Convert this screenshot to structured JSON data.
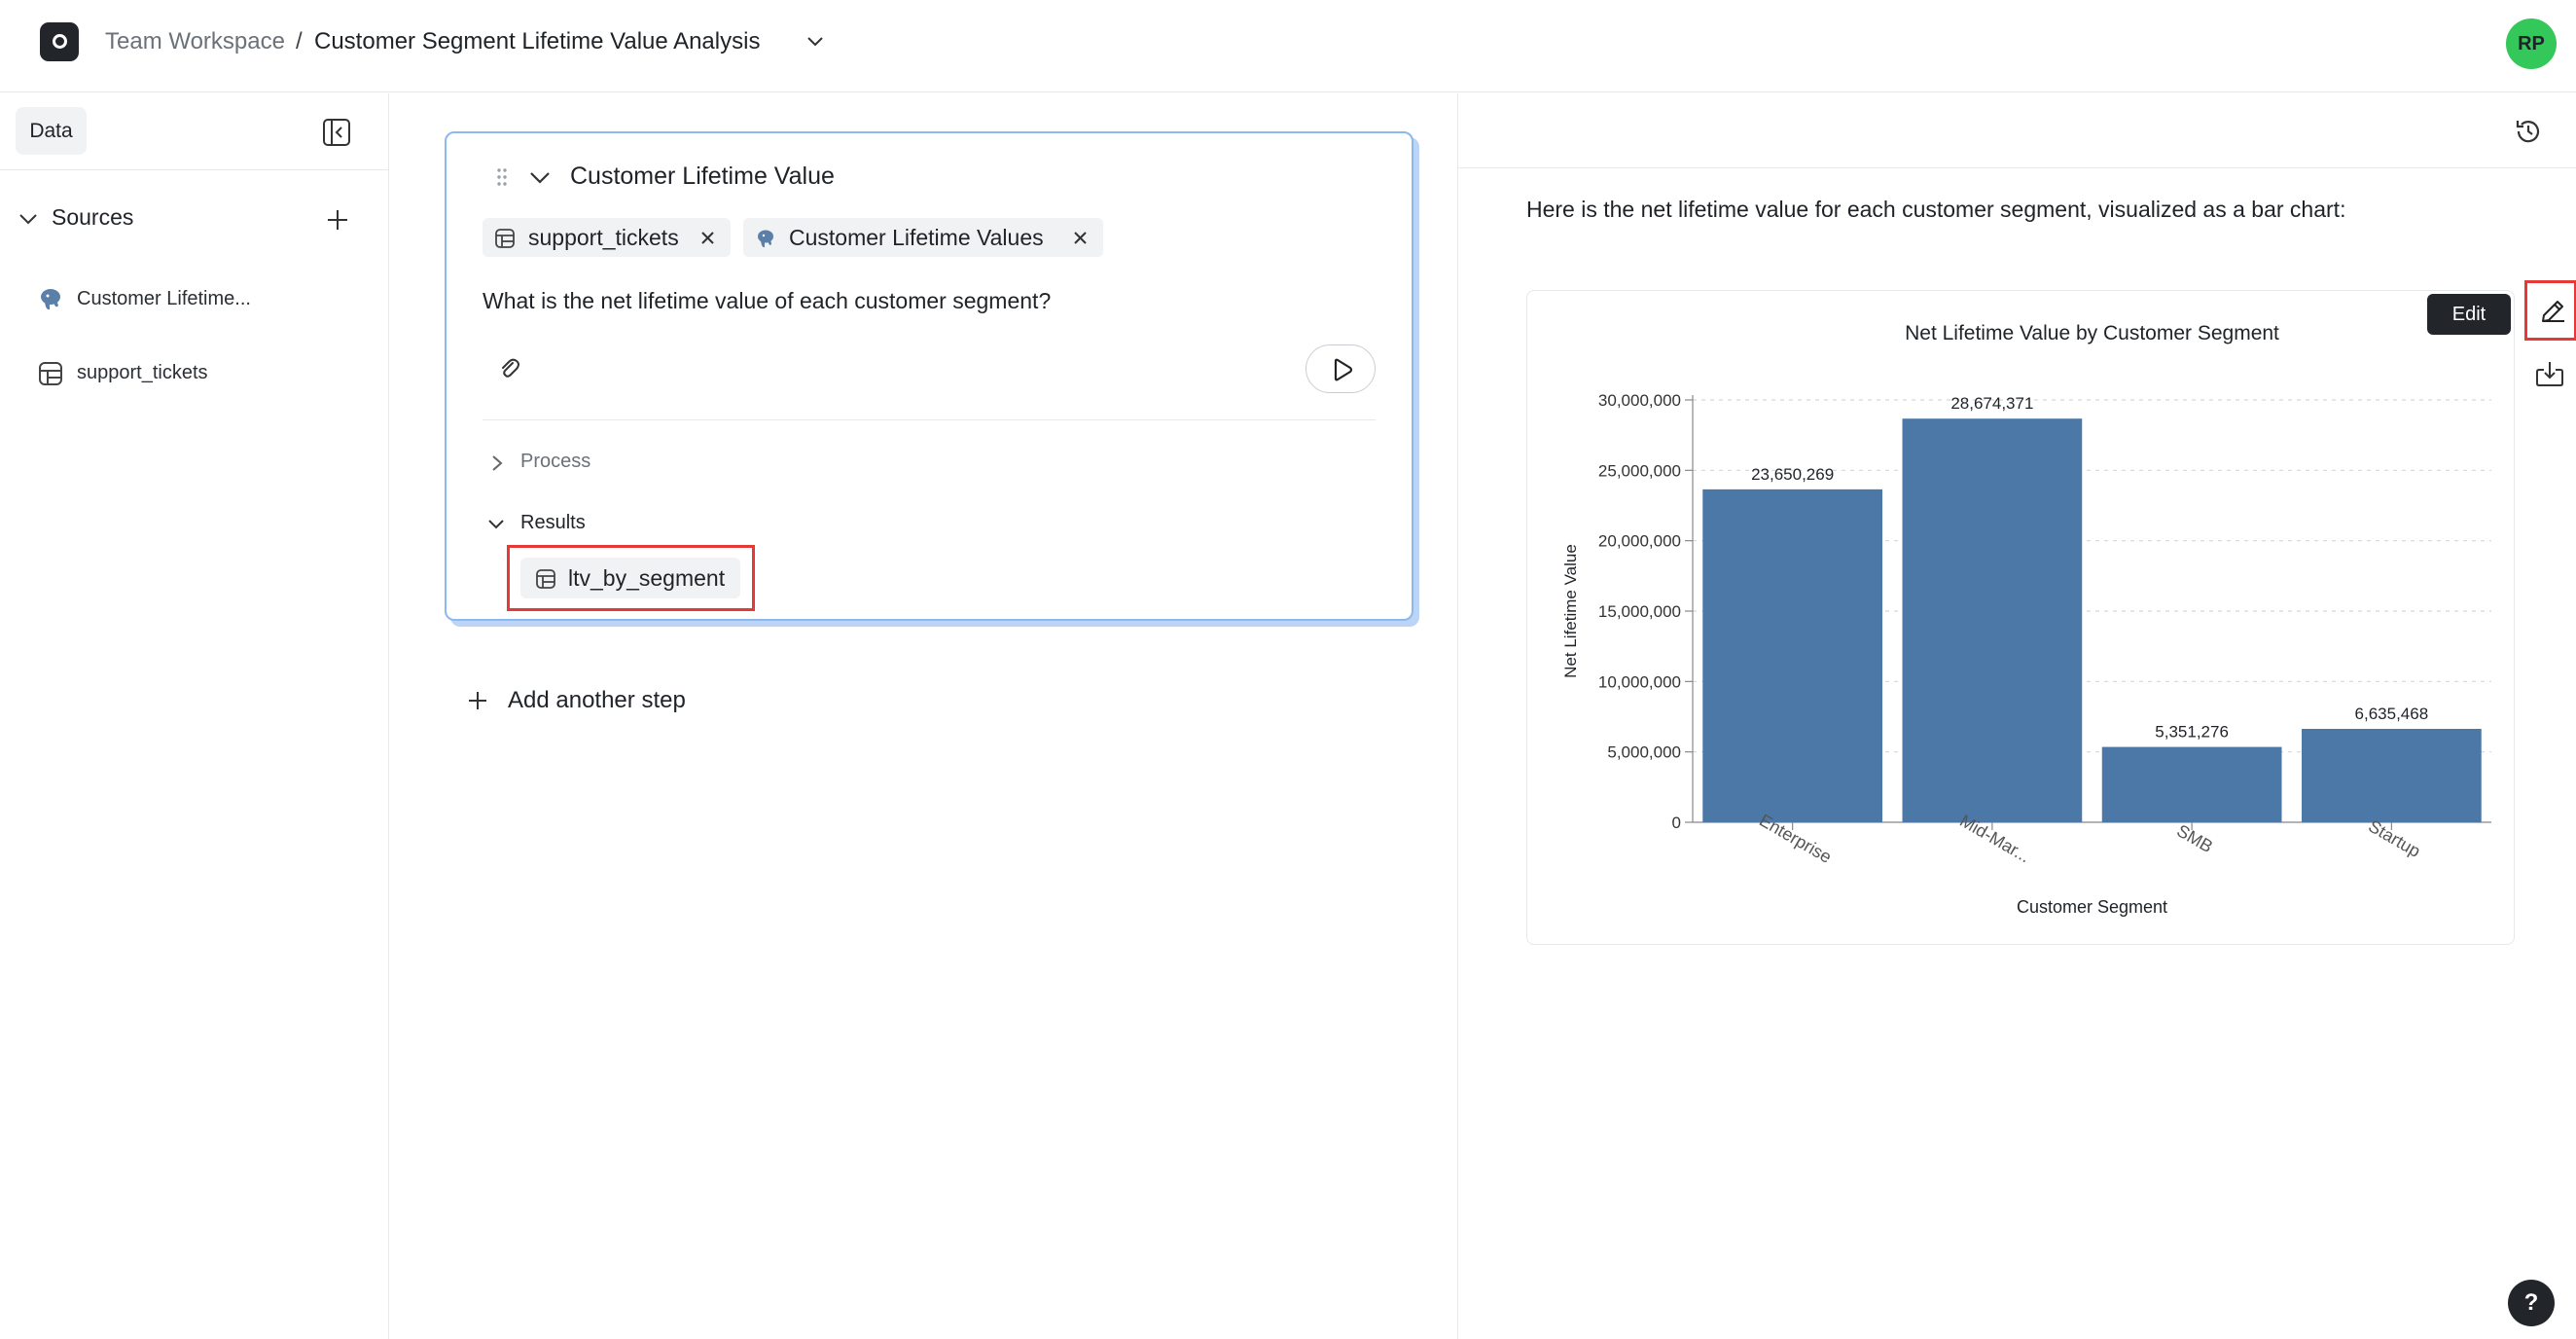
{
  "header": {
    "workspace": "Team Workspace",
    "separator": "/",
    "title": "Customer Segment Lifetime Value Analysis",
    "avatar_initials": "RP"
  },
  "sidebar": {
    "tab_label": "Data",
    "sources_label": "Sources",
    "items": [
      {
        "label": "Customer Lifetime...",
        "icon": "postgres-icon"
      },
      {
        "label": "support_tickets",
        "icon": "table-icon"
      }
    ]
  },
  "step": {
    "title": "Customer Lifetime Value",
    "chips": [
      {
        "label": "support_tickets",
        "icon": "table-icon"
      },
      {
        "label": "Customer Lifetime Values",
        "icon": "postgres-icon"
      }
    ],
    "question": "What is the net lifetime value of each customer segment?",
    "process_label": "Process",
    "results_label": "Results",
    "result_item": "ltv_by_segment"
  },
  "add_step_label": "Add another step",
  "right": {
    "answer": "Here is the net lifetime value for each customer segment, visualized as a bar chart:",
    "edit_tooltip": "Edit",
    "help_label": "?"
  },
  "colors": {
    "bar": "#4c78a8",
    "accent_red": "#e53935",
    "avatar": "#34c759"
  },
  "chart_data": {
    "type": "bar",
    "title": "Net Lifetime Value by Customer Segment",
    "xlabel": "Customer Segment",
    "ylabel": "Net Lifetime Value",
    "categories": [
      "Enterprise",
      "Mid-Mar...",
      "SMB",
      "Startup"
    ],
    "values": [
      23650269,
      28674371,
      5351276,
      6635468
    ],
    "value_labels": [
      "23,650,269",
      "28,674,371",
      "5,351,276",
      "6,635,468"
    ],
    "y_ticks": [
      0,
      5000000,
      10000000,
      15000000,
      20000000,
      25000000,
      30000000
    ],
    "y_tick_labels": [
      "0",
      "5,000,000",
      "10,000,000",
      "15,000,000",
      "20,000,000",
      "25,000,000",
      "30,000,000"
    ],
    "ylim": [
      0,
      30000000
    ],
    "grid": true
  }
}
